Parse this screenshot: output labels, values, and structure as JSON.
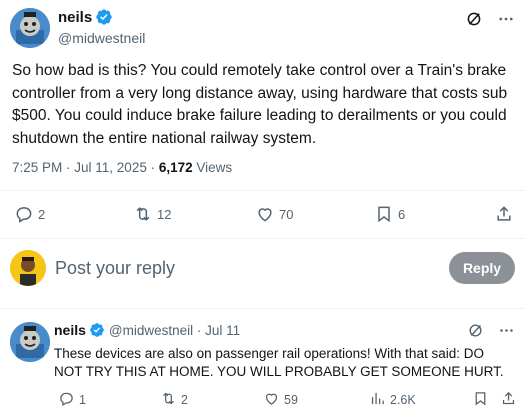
{
  "main_tweet": {
    "display_name": "neils",
    "handle": "@midwestneil",
    "text": "So how bad is this? You could remotely take control over a Train's brake controller from a very long distance away, using hardware that costs sub $500. You could induce brake failure leading to derailments or you could shutdown the entire national railway system.",
    "time": "7:25 PM · Jul 11, 2025 · ",
    "views_count": "6,172",
    "views_label": " Views",
    "actions": {
      "replies": "2",
      "reposts": "12",
      "likes": "70",
      "bookmarks": "6"
    }
  },
  "reply_composer": {
    "placeholder": "Post your reply",
    "button_label": "Reply"
  },
  "reply_tweet": {
    "display_name": "neils",
    "handle_date": "@midwestneil · Jul 11",
    "text": "These devices are also on passenger rail operations! With that said: DO NOT TRY THIS AT HOME. YOU WILL PROBABLY GET SOMEONE HURT.",
    "actions": {
      "replies": "1",
      "reposts": "2",
      "likes": "59",
      "views": "2.6K"
    }
  },
  "colors": {
    "verified_blue": "#1d9bf0",
    "muted_text": "#536471",
    "reply_button_bg": "#8b9196"
  }
}
